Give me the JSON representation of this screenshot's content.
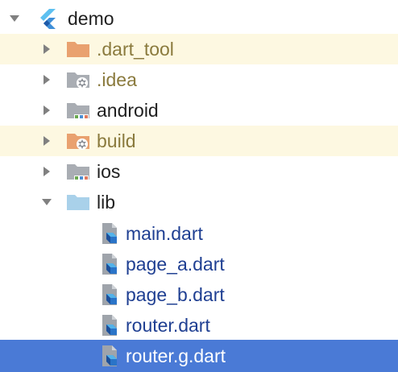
{
  "tree": {
    "root": {
      "label": "demo",
      "icon": "flutter-icon",
      "expanded": true
    },
    "items": [
      {
        "label": ".dart_tool",
        "icon": "folder-orange-icon",
        "expanded": false,
        "style": "excluded"
      },
      {
        "label": ".idea",
        "icon": "folder-gear-icon",
        "expanded": false,
        "style": "excluded"
      },
      {
        "label": "android",
        "icon": "folder-module-icon",
        "expanded": false,
        "style": "dir"
      },
      {
        "label": "build",
        "icon": "folder-orange-gear-icon",
        "expanded": false,
        "style": "excluded"
      },
      {
        "label": "ios",
        "icon": "folder-module-icon",
        "expanded": false,
        "style": "dir"
      },
      {
        "label": "lib",
        "icon": "folder-blue-icon",
        "expanded": true,
        "style": "dir"
      }
    ],
    "files": [
      {
        "label": "main.dart",
        "icon": "dart-file-icon"
      },
      {
        "label": "page_a.dart",
        "icon": "dart-file-icon"
      },
      {
        "label": "page_b.dart",
        "icon": "dart-file-icon"
      },
      {
        "label": "router.dart",
        "icon": "dart-file-icon"
      },
      {
        "label": "router.g.dart",
        "icon": "dart-file-icon",
        "selected": true
      }
    ]
  },
  "colors": {
    "selection": "#4a7ad6",
    "highlight_row": "#fdf8e1",
    "excluded_text": "#8a7a3d",
    "dart_file_text": "#1f3f92"
  }
}
